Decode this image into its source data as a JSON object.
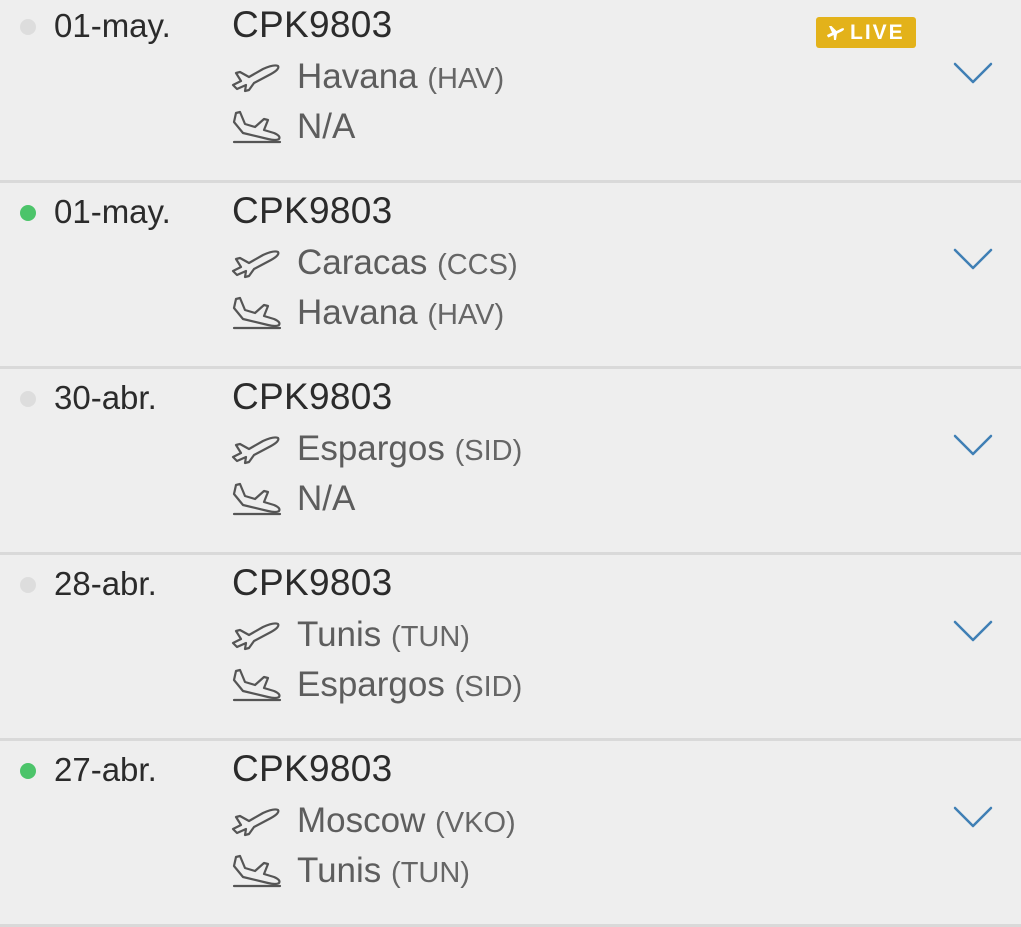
{
  "colors": {
    "background": "#eeeeee",
    "status_inactive": "#dddddd",
    "status_active": "#4cc46a",
    "live_badge": "#e3b21a",
    "chevron": "#3f7fb5"
  },
  "live_badge": {
    "label": "LIVE",
    "icon": "airplane-icon"
  },
  "flights": [
    {
      "date": "01-may.",
      "flight_number": "CPK9803",
      "status": "inactive",
      "live": true,
      "departure": {
        "city": "Havana",
        "code": "(HAV)"
      },
      "arrival": {
        "city": "N/A",
        "code": ""
      }
    },
    {
      "date": "01-may.",
      "flight_number": "CPK9803",
      "status": "active",
      "live": false,
      "departure": {
        "city": "Caracas",
        "code": "(CCS)"
      },
      "arrival": {
        "city": "Havana",
        "code": "(HAV)"
      }
    },
    {
      "date": "30-abr.",
      "flight_number": "CPK9803",
      "status": "inactive",
      "live": false,
      "departure": {
        "city": "Espargos",
        "code": "(SID)"
      },
      "arrival": {
        "city": "N/A",
        "code": ""
      }
    },
    {
      "date": "28-abr.",
      "flight_number": "CPK9803",
      "status": "inactive",
      "live": false,
      "departure": {
        "city": "Tunis",
        "code": "(TUN)"
      },
      "arrival": {
        "city": "Espargos",
        "code": "(SID)"
      }
    },
    {
      "date": "27-abr.",
      "flight_number": "CPK9803",
      "status": "active",
      "live": false,
      "departure": {
        "city": "Moscow",
        "code": "(VKO)"
      },
      "arrival": {
        "city": "Tunis",
        "code": "(TUN)"
      }
    }
  ]
}
